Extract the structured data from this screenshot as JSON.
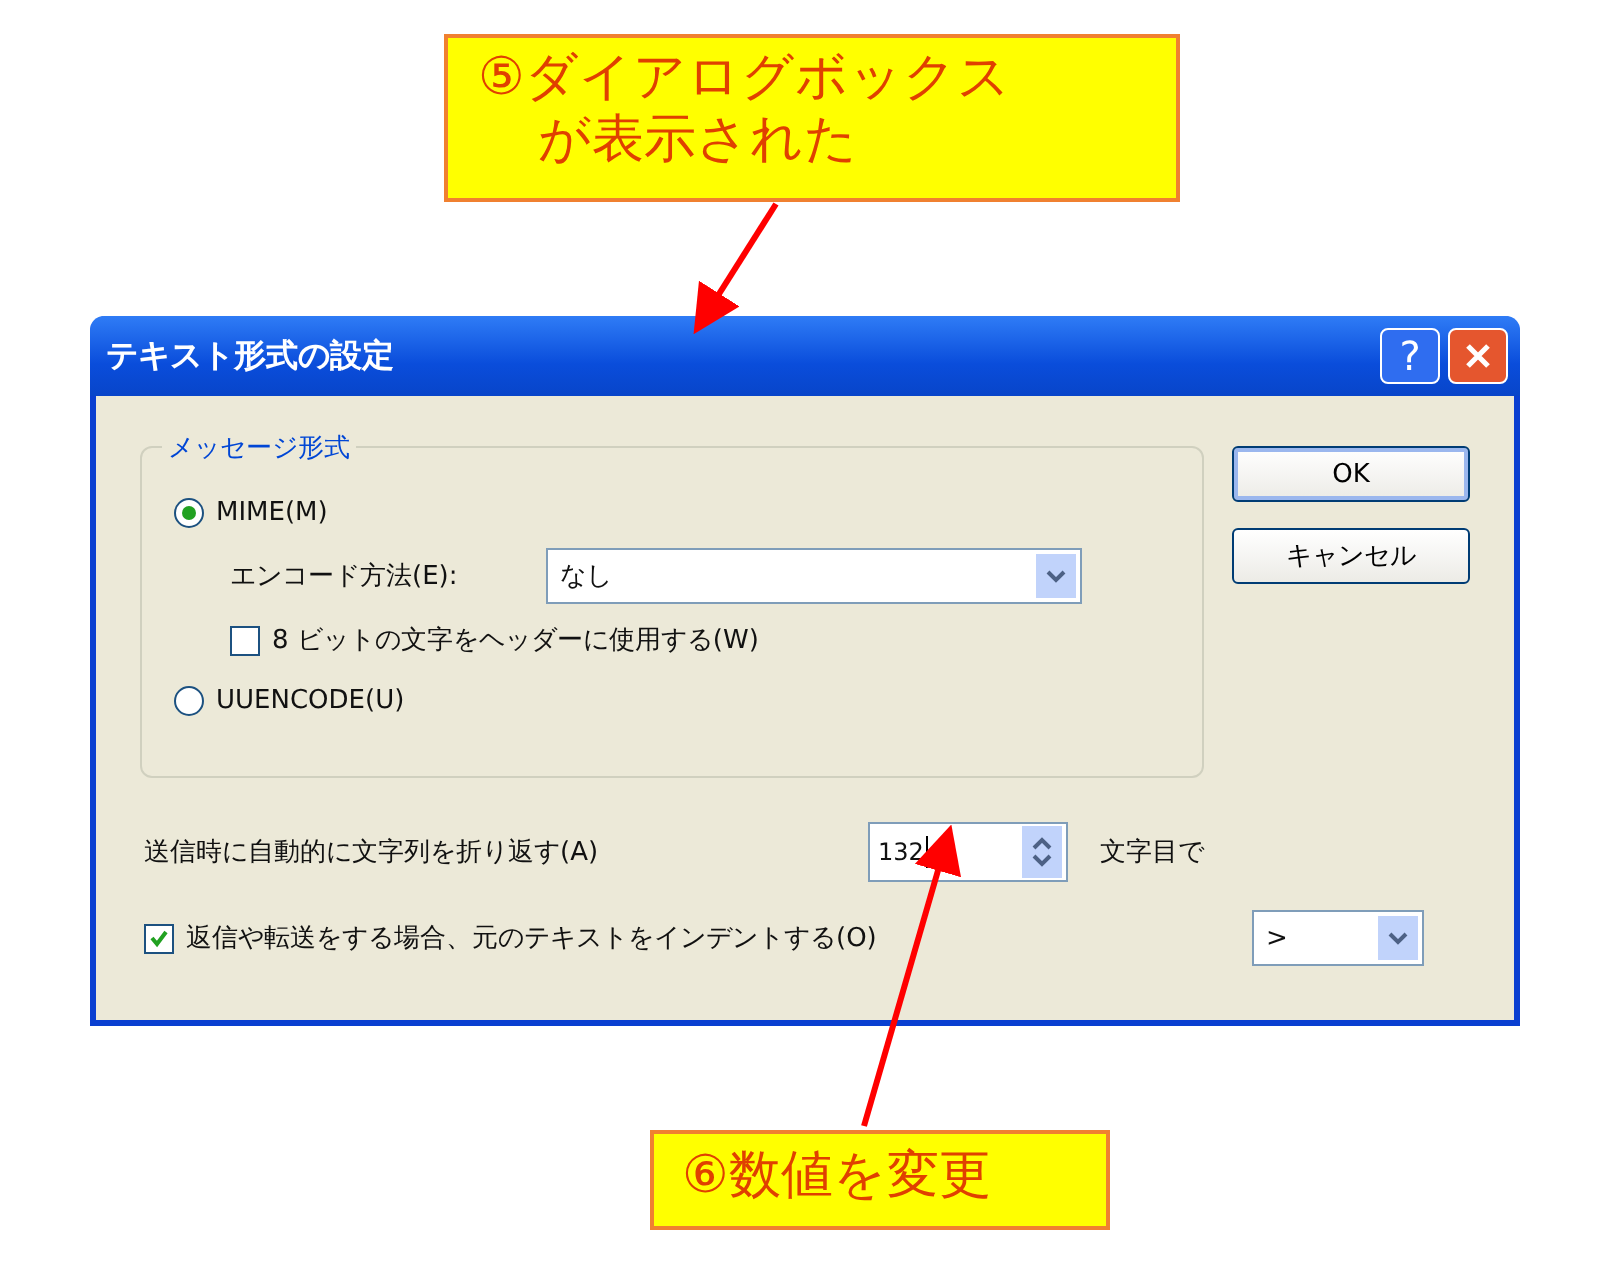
{
  "callouts": [
    {
      "lines": [
        "⑤ダイアログボックス",
        "が表示された"
      ]
    },
    {
      "lines": [
        "⑥数値を変更"
      ]
    }
  ],
  "dialog": {
    "title": "テキスト形式の設定",
    "help_button": "?",
    "group": {
      "title": "メッセージ形式",
      "items": [
        {
          "kind": "radio",
          "label": "MIME(M)",
          "selected": true
        },
        {
          "kind": "select",
          "label": "エンコード方法(E):",
          "value": "なし"
        },
        {
          "kind": "checkbox",
          "label": "8 ビットの文字をヘッダーに使用する(W)",
          "checked": false
        },
        {
          "kind": "radio",
          "label": "UUENCODE(U)",
          "selected": false
        }
      ]
    },
    "wrap": {
      "label": "送信時に自動的に文字列を折り返す(A)",
      "value": "132",
      "suffix": "文字目で"
    },
    "indent": {
      "label": "返信や転送をする場合、元のテキストをインデントする(O)",
      "checked": true,
      "value": ">"
    },
    "buttons": [
      "OK",
      "キャンセル"
    ]
  }
}
